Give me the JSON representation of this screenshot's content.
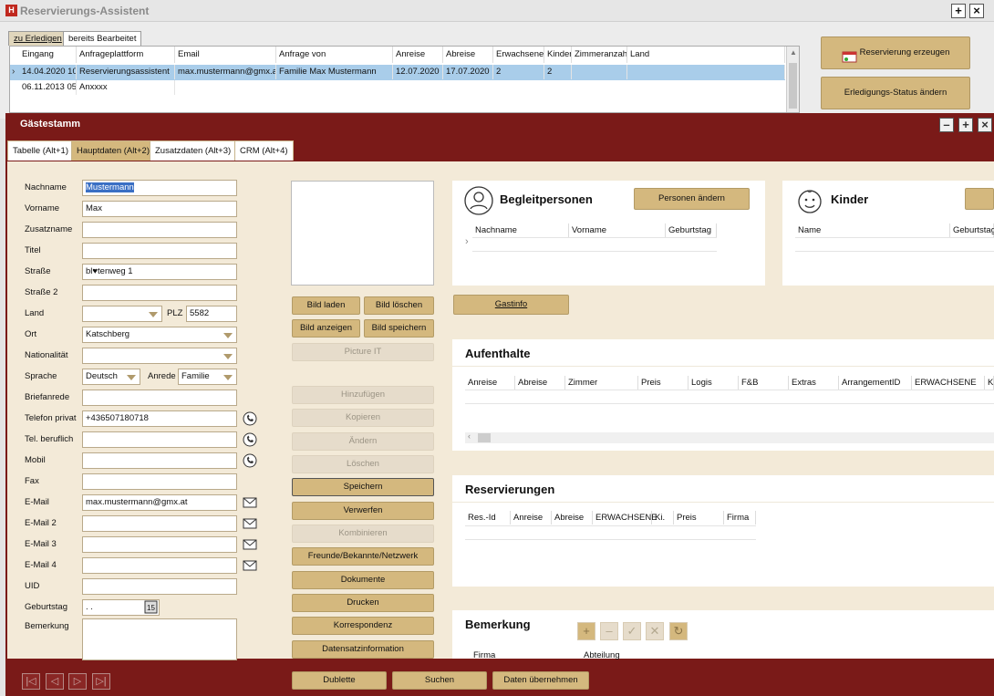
{
  "bg_window": {
    "title": "Reservierungs-Assistent",
    "tabs": [
      "zu Erledigen",
      "bereits Bearbeitet"
    ],
    "columns": [
      "Eingang",
      "Anfrageplattform",
      "Email",
      "Anfrage von",
      "Anreise",
      "Abreise",
      "Erwachsene",
      "Kinder",
      "Zimmeranzahl",
      "Land"
    ],
    "rows": [
      [
        "14.04.2020 10",
        "Reservierungsassistent",
        "max.mustermann@gmx.at",
        "Familie  Max Mustermann",
        "12.07.2020",
        "17.07.2020",
        "2",
        "2",
        "",
        ""
      ],
      [
        "06.11.2013 05",
        "Anxxxx",
        "",
        "",
        "",
        "",
        "",
        "",
        "",
        ""
      ]
    ],
    "btn_reservation": "Reservierung erzeugen",
    "btn_status": "Erledigungs-Status ändern"
  },
  "main": {
    "title": "Gästestamm",
    "tabs": [
      "Tabelle (Alt+1)",
      "Hauptdaten (Alt+2)",
      "Zusatzdaten (Alt+3)",
      "CRM (Alt+4)"
    ],
    "form": {
      "nachname_label": "Nachname",
      "nachname": "Mustermann",
      "vorname_label": "Vorname",
      "vorname": "Max",
      "zusatzname_label": "Zusatzname",
      "titel_label": "Titel",
      "strasse_label": "Straße",
      "strasse": "bl♥tenweg 1",
      "strasse2_label": "Straße 2",
      "land_label": "Land",
      "plz_label": "PLZ",
      "plz": "5582",
      "ort_label": "Ort",
      "ort": "Katschberg",
      "nationalitaet_label": "Nationalität",
      "sprache_label": "Sprache",
      "sprache": "Deutsch",
      "anrede_label": "Anrede",
      "anrede": "Familie",
      "briefanrede_label": "Briefanrede",
      "tel_privat_label": "Telefon privat",
      "tel_privat": "+436507180718",
      "tel_beruflich_label": "Tel. beruflich",
      "mobil_label": "Mobil",
      "fax_label": "Fax",
      "email_label": "E-Mail",
      "email": "max.mustermann@gmx.at",
      "email2_label": "E-Mail 2",
      "email3_label": "E-Mail 3",
      "email4_label": "E-Mail 4",
      "uid_label": "UID",
      "geburtstag_label": "Geburtstag",
      "geburtstag": " .  .",
      "bemerkung_label": "Bemerkung"
    },
    "image_buttons": [
      "Bild laden",
      "Bild löschen",
      "Bild anzeigen",
      "Bild speichern",
      "Picture IT"
    ],
    "actions": [
      "Hinzufügen",
      "Kopieren",
      "Ändern",
      "Löschen",
      "Speichern",
      "Verwerfen",
      "Kombinieren",
      "Freunde/Bekannte/Netzwerk",
      "Dokumente",
      "Drucken",
      "Korrespondenz",
      "Datensatzinformation"
    ],
    "begleit": {
      "title": "Begleitpersonen",
      "button": "Personen ändern",
      "columns": [
        "Nachname",
        "Vorname",
        "Geburtstag"
      ]
    },
    "kinder": {
      "title": "Kinder",
      "columns": [
        "Name",
        "Geburtstag"
      ]
    },
    "gastinfo": "Gastinfo",
    "aufenthalte": {
      "title": "Aufenthalte",
      "columns": [
        "Anreise",
        "Abreise",
        "Zimmer",
        "Preis",
        "Logis",
        "F&B",
        "Extras",
        "ArrangementID",
        "ERWACHSENE",
        "K"
      ]
    },
    "reservierungen": {
      "title": "Reservierungen",
      "columns": [
        "Res.-Id",
        "Anreise",
        "Abreise",
        "ERWACHSENE",
        "Ki.",
        "Preis",
        "Firma"
      ]
    },
    "bemerkung": {
      "title": "Bemerkung",
      "columns": [
        "Firma",
        "Abteilung"
      ]
    },
    "footer": [
      "Dublette",
      "Suchen",
      "Daten übernehmen"
    ]
  }
}
